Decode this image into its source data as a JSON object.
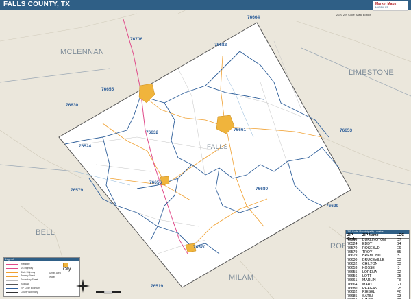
{
  "header": {
    "title": "FALLS COUNTY, TX",
    "edition": "2020 ZIP Code Basic Edition",
    "brand_name": "Market Maps",
    "brand_tagline": "MAPSALES"
  },
  "neighbors": [
    {
      "label": "MCLENNAN"
    },
    {
      "label": "LIMESTONE"
    },
    {
      "label": "BELL"
    },
    {
      "label": "ROBERTSON"
    },
    {
      "label": "MILAM"
    }
  ],
  "county_label": "FALLS",
  "zip_labels": [
    {
      "zip": "76664"
    },
    {
      "zip": "76706"
    },
    {
      "zip": "76682"
    },
    {
      "zip": "76655"
    },
    {
      "zip": "76630"
    },
    {
      "zip": "76661"
    },
    {
      "zip": "76632"
    },
    {
      "zip": "76524"
    },
    {
      "zip": "76653"
    },
    {
      "zip": "76656"
    },
    {
      "zip": "76680"
    },
    {
      "zip": "76579"
    },
    {
      "zip": "76629"
    },
    {
      "zip": "76570"
    },
    {
      "zip": "76519"
    }
  ],
  "zip_table": {
    "title": "ZIP Code / Municipality Locator",
    "columns": [
      "ZIP Code",
      "ZIP Name",
      "LOC"
    ],
    "rows": [
      [
        "76519",
        "BURLINGTON",
        "D7"
      ],
      [
        "76524",
        "EDDY",
        "B4"
      ],
      [
        "76570",
        "ROSEBUD",
        "E6"
      ],
      [
        "76579",
        "TROY",
        "B5"
      ],
      [
        "76629",
        "BREMOND",
        "I5"
      ],
      [
        "76630",
        "BRUCEVILLE",
        "C3"
      ],
      [
        "76632",
        "CHILTON",
        "D3"
      ],
      [
        "76653",
        "KOSSE",
        "I3"
      ],
      [
        "76655",
        "LORENA",
        "D2"
      ],
      [
        "76656",
        "LOTT",
        "D5"
      ],
      [
        "76661",
        "MARLIN",
        "F3"
      ],
      [
        "76664",
        "MART",
        "G1"
      ],
      [
        "76680",
        "REAGAN",
        "G5"
      ],
      [
        "76682",
        "RIESEL",
        "F2"
      ],
      [
        "76685",
        "SATIN",
        "D3"
      ],
      [
        "76706",
        "WACO",
        "D2"
      ]
    ]
  },
  "legend": {
    "title": "Legend",
    "items": [
      {
        "label": "Interstate",
        "color": "#e04a8a"
      },
      {
        "label": "US Highway",
        "color": "#e04a8a"
      },
      {
        "label": "State Highway",
        "color": "#f0a030"
      },
      {
        "label": "Primary Street",
        "color": "#f0a030"
      },
      {
        "label": "Secondary Street",
        "color": "#bbbbbb"
      },
      {
        "label": "Railroad",
        "color": "#555555"
      },
      {
        "label": "ZIP Code Boundary",
        "color": "#2f5f9a"
      },
      {
        "label": "County Boundary",
        "color": "#333333"
      }
    ],
    "right_items": [
      {
        "label": "Urban Area"
      },
      {
        "label": "Water"
      }
    ],
    "city_label": "City"
  },
  "colors": {
    "outside_county": "#ebe7dc",
    "county_fill": "#ffffff",
    "zip_boundary": "#2f5f9a",
    "highway": "#e04a8a",
    "state_road": "#f0a030",
    "urban": "#f0b43c",
    "title_bar": "#2f5f86"
  }
}
